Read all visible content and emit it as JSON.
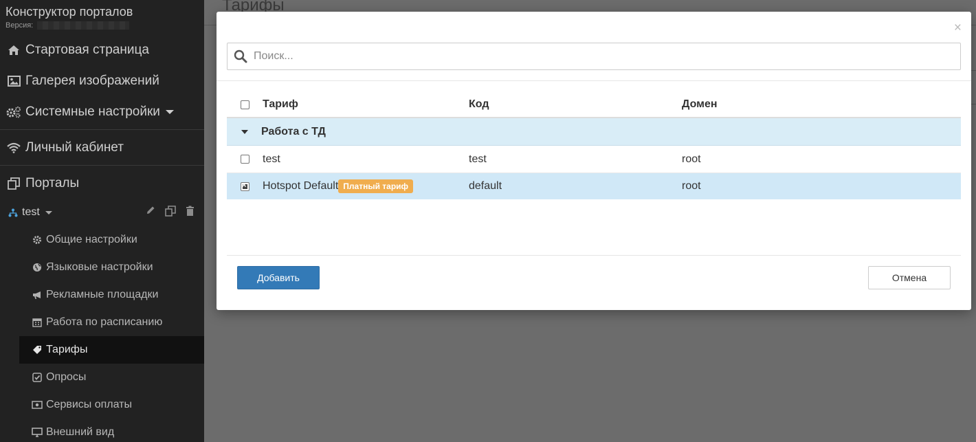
{
  "sidebar": {
    "brand_title": "Конструктор порталов",
    "version_label": "Версия:",
    "main_items": [
      {
        "label": "Стартовая страница",
        "icon": "home-icon"
      },
      {
        "label": "Галерея изображений",
        "icon": "image-icon"
      },
      {
        "label": "Системные настройки",
        "icon": "cogs-icon"
      }
    ],
    "cabinet_label": "Личный кабинет",
    "portals_label": "Порталы",
    "portal": {
      "name": "test"
    },
    "sub_items": [
      {
        "label": "Общие настройки",
        "icon": "gear-icon"
      },
      {
        "label": "Языковые настройки",
        "icon": "globe-icon"
      },
      {
        "label": "Рекламные площадки",
        "icon": "bullhorn-icon"
      },
      {
        "label": "Работа по расписанию",
        "icon": "calendar-icon"
      },
      {
        "label": "Тарифы",
        "icon": "tag-icon",
        "active": true
      },
      {
        "label": "Опросы",
        "icon": "check-square-icon"
      },
      {
        "label": "Сервисы оплаты",
        "icon": "money-icon"
      },
      {
        "label": "Внешний вид",
        "icon": "monitor-icon"
      }
    ]
  },
  "page": {
    "title": "Тарифы"
  },
  "modal": {
    "search_placeholder": "Поиск...",
    "columns": {
      "tariff": "Тариф",
      "code": "Код",
      "domain": "Домен"
    },
    "group_label": "Работа с ТД",
    "rows": [
      {
        "name": "test",
        "code": "test",
        "domain": "root",
        "checked": false
      },
      {
        "name": "Hotspot Default",
        "badge": "Платный тариф",
        "code": "default",
        "domain": "root",
        "checked": true
      }
    ],
    "add_label": "Добавить",
    "cancel_label": "Отмена"
  },
  "colors": {
    "primary": "#337ab7",
    "badge": "#f0ad4e",
    "group_bg": "#d9edf7",
    "selected_bg": "#d0e8f7"
  }
}
